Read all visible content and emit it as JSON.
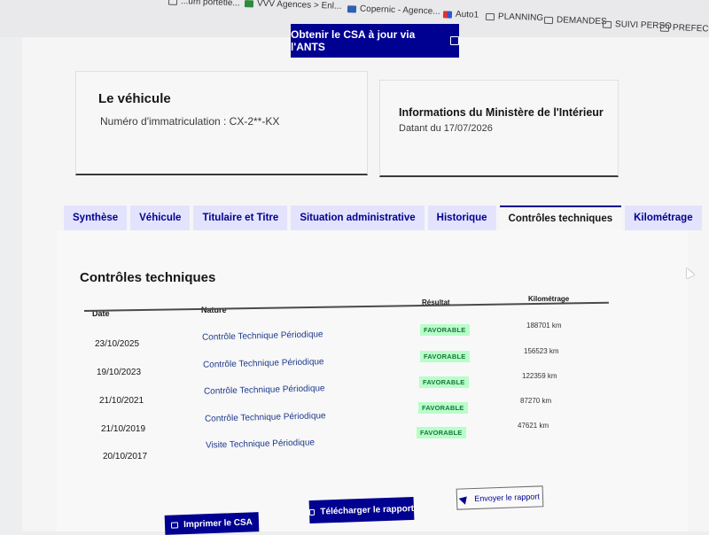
{
  "bookmarks": [
    {
      "label": "...um portetle...",
      "icon": "folder-icon"
    },
    {
      "label": "VVV Agences > Enl...",
      "icon": "green-square-icon"
    },
    {
      "label": "Copernic - Agence...",
      "icon": "blue-square-icon"
    },
    {
      "label": "Auto1",
      "icon": "auto1-icon"
    },
    {
      "label": "PLANNING",
      "icon": "folder-icon"
    },
    {
      "label": "DEMANDES",
      "icon": "folder-icon"
    },
    {
      "label": "SUIVI PERSO",
      "icon": "folder-icon"
    },
    {
      "label": "PREFECTURE",
      "icon": "folder-icon"
    }
  ],
  "ants_button": {
    "label": "Obtenir le CSA à jour via l'ANTS",
    "icon": "external-link-icon"
  },
  "vehicle_card": {
    "title": "Le véhicule",
    "subtitle": "Numéro d'immatriculation : CX-2**-KX"
  },
  "ministry_card": {
    "title": "Informations du Ministère de l'Intérieur",
    "subtitle": "Datant du 17/07/2026"
  },
  "tabs": [
    {
      "label": "Synthèse"
    },
    {
      "label": "Véhicule"
    },
    {
      "label": "Titulaire et Titre"
    },
    {
      "label": "Situation administrative"
    },
    {
      "label": "Historique"
    },
    {
      "label": "Contrôles techniques",
      "active": true
    },
    {
      "label": "Kilométrage"
    }
  ],
  "section_title": "Contrôles techniques",
  "table": {
    "headers": {
      "date": "Date",
      "nature": "Nature",
      "result": "Résultat",
      "mileage": "Kilométrage"
    },
    "rows": [
      {
        "date": "23/10/2025",
        "nature": "Contrôle Technique Périodique",
        "result": "FAVORABLE",
        "mileage": "188701 km"
      },
      {
        "date": "19/10/2023",
        "nature": "Contrôle Technique Périodique",
        "result": "FAVORABLE",
        "mileage": "156523 km"
      },
      {
        "date": "21/10/2021",
        "nature": "Contrôle Technique Périodique",
        "result": "FAVORABLE",
        "mileage": "122359 km"
      },
      {
        "date": "21/10/2019",
        "nature": "Contrôle Technique Périodique",
        "result": "FAVORABLE",
        "mileage": "87270 km"
      },
      {
        "date": "20/10/2017",
        "nature": "Visite Technique Périodique",
        "result": "FAVORABLE",
        "mileage": "47621 km"
      }
    ]
  },
  "actions": {
    "print": {
      "label": "Imprimer le CSA",
      "icon": "printer-icon"
    },
    "download": {
      "label": "Télécharger le rapport",
      "icon": "printer-icon"
    },
    "send": {
      "label": "Envoyer le rapport",
      "icon": "send-icon"
    }
  },
  "colors": {
    "primary": "#000091",
    "tab_bg": "#e3e3fd",
    "success_text": "#18753c",
    "success_bg": "#b8fec9"
  }
}
